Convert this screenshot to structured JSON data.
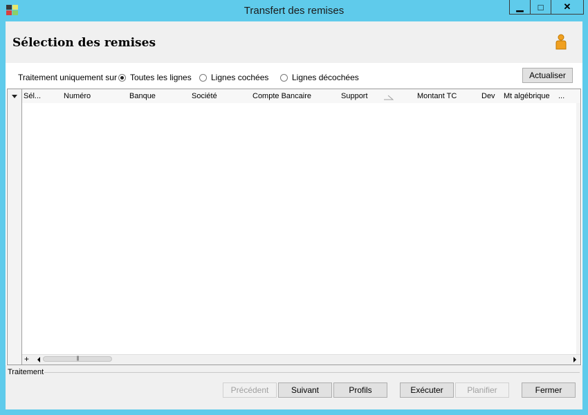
{
  "window": {
    "title": "Transfert des remises",
    "minimize_glyph": "▁",
    "maximize_glyph": "□",
    "close_glyph": "✕"
  },
  "header": {
    "title": "Sélection des remises",
    "user_icon": "person-icon"
  },
  "filter": {
    "label": "Traitement uniquement sur :",
    "options": [
      {
        "label": "Toutes les lignes",
        "selected": true
      },
      {
        "label": "Lignes cochées",
        "selected": false
      },
      {
        "label": "Lignes décochées",
        "selected": false
      }
    ],
    "refresh_button": "Actualiser"
  },
  "grid": {
    "columns": [
      "Sél...",
      "Numéro",
      "Banque",
      "Société",
      "Compte Bancaire",
      "Support",
      "Montant TC",
      "Dev",
      "Mt algébrique",
      "..."
    ],
    "rows": [],
    "add_glyph": "+",
    "scroll_thumb_glyph": "|||"
  },
  "footer": {
    "section_label": "Traitement",
    "buttons": {
      "previous": "Précédent",
      "next": "Suivant",
      "profiles": "Profils",
      "execute": "Exécuter",
      "schedule": "Planifier",
      "close": "Fermer"
    }
  },
  "colors": {
    "titlebar": "#5fcbeb",
    "header_bg": "#f0f0f0",
    "button_bg": "#e1e1e1"
  }
}
